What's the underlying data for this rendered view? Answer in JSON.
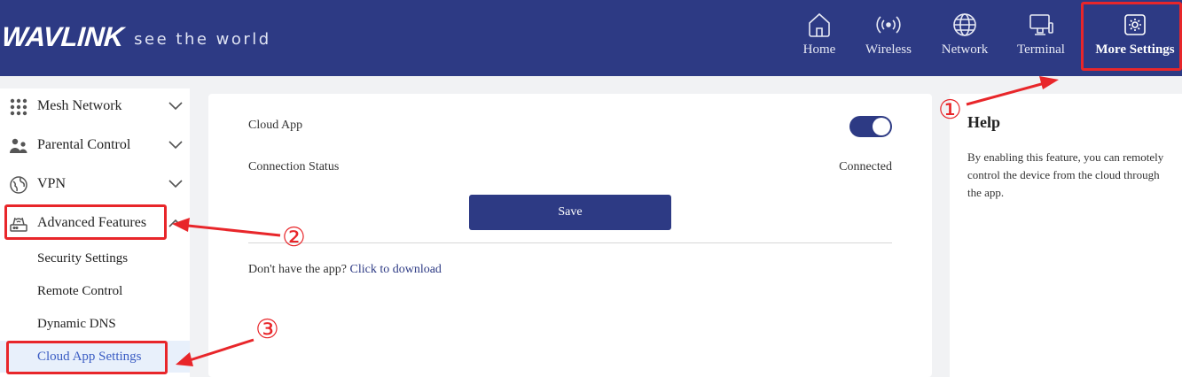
{
  "brand": {
    "name": "WAVLINK",
    "tagline": "see the world"
  },
  "nav": [
    {
      "label": "Home",
      "icon": "home-icon"
    },
    {
      "label": "Wireless",
      "icon": "wireless-icon"
    },
    {
      "label": "Network",
      "icon": "globe-icon"
    },
    {
      "label": "Terminal",
      "icon": "monitor-icon"
    },
    {
      "label": "More Settings",
      "icon": "gear-icon",
      "active": true
    }
  ],
  "sidebar": {
    "groups": [
      {
        "label": "Mesh Network",
        "icon": "mesh-grid-icon"
      },
      {
        "label": "Parental Control",
        "icon": "parental-icon"
      },
      {
        "label": "VPN",
        "icon": "vpn-globe-icon"
      },
      {
        "label": "Advanced Features",
        "icon": "router-icon",
        "expanded": true
      }
    ],
    "sub_items": [
      {
        "label": "Security Settings"
      },
      {
        "label": "Remote Control"
      },
      {
        "label": "Dynamic DNS"
      },
      {
        "label": "Cloud App Settings",
        "active": true
      }
    ]
  },
  "main": {
    "cloud_app_label": "Cloud App",
    "cloud_app_enabled": true,
    "connection_status_label": "Connection Status",
    "connection_status_value": "Connected",
    "save_label": "Save",
    "download_prompt": "Don't have the app?",
    "download_link": "Click to download"
  },
  "help": {
    "title": "Help",
    "text": "By enabling this feature, you can remotely control the device from the cloud through the app."
  },
  "annotations": [
    "①",
    "②",
    "③"
  ],
  "colors": {
    "brand": "#2d3a84",
    "annotation": "#e8262a",
    "active_sub_bg": "#e8f0fb",
    "active_sub_text": "#3a5cc3"
  }
}
